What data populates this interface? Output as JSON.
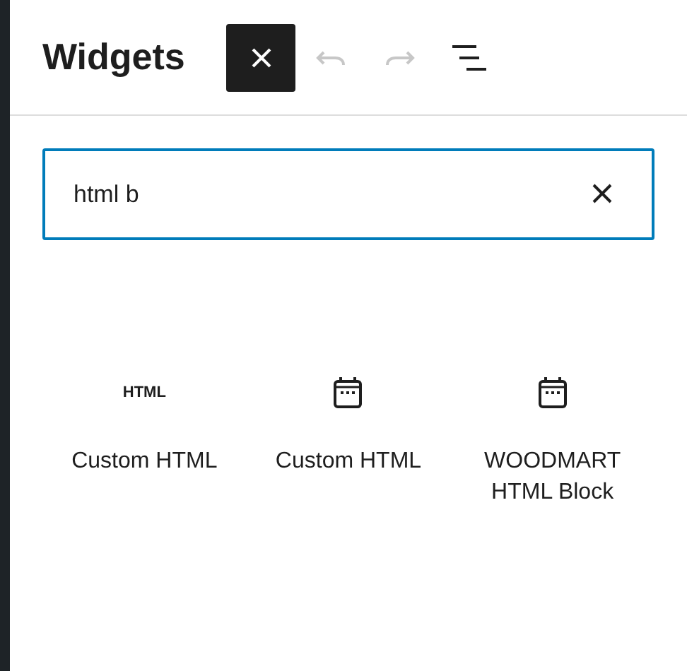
{
  "header": {
    "title": "Widgets",
    "inserter_toggle": {
      "pressed": true
    },
    "undo": {
      "disabled": true
    },
    "redo": {
      "disabled": true
    }
  },
  "search": {
    "value": "html b"
  },
  "results": [
    {
      "kind": "text_icon",
      "icon_text": "HTML",
      "label": "Custom HTML"
    },
    {
      "kind": "calendar",
      "label": "Custom HTML"
    },
    {
      "kind": "calendar",
      "label": "WOODMART HTML Block"
    }
  ]
}
